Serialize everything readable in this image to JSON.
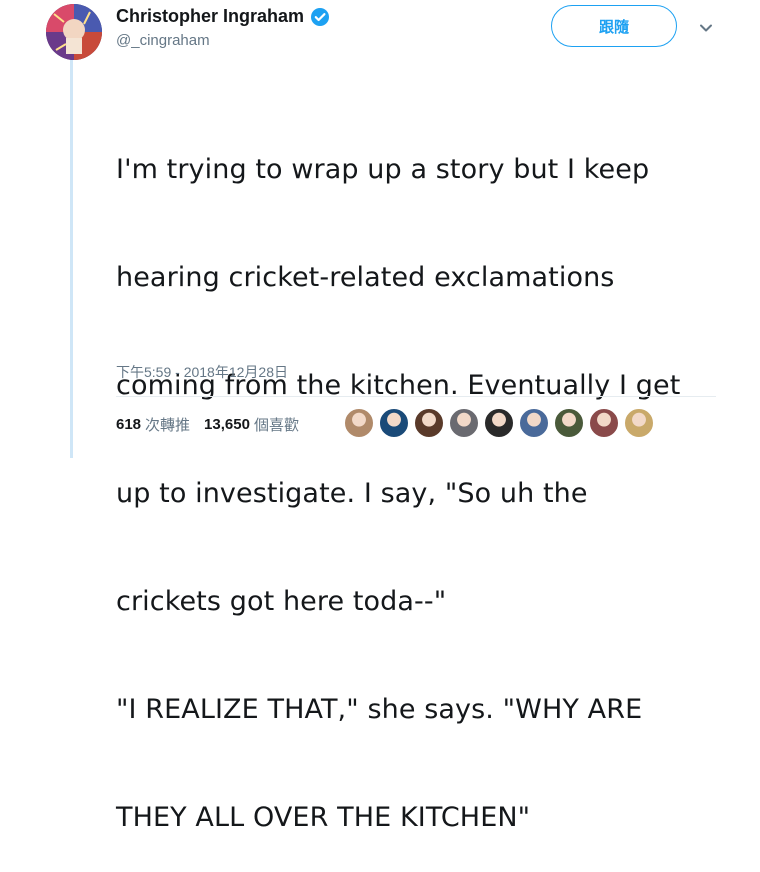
{
  "author": {
    "display_name": "Christopher Ingraham",
    "handle": "@_cingraham",
    "verified": true
  },
  "follow_button": {
    "label": "跟隨"
  },
  "tweet": {
    "lines": [
      "I'm trying to wrap up a story but I keep",
      "hearing cricket-related exclamations",
      "coming from the kitchen. Eventually I get",
      "up to investigate. I say, \"So uh the",
      "crickets got here toda--\"",
      "\"I REALIZE THAT,\" she says. \"WHY ARE",
      "THEY ALL OVER THE KITCHEN\""
    ],
    "timestamp": "下午5:59 - 2018年12月28日"
  },
  "stats": {
    "retweets_count": "618",
    "retweets_label": "次轉推",
    "likes_count": "13,650",
    "likes_label": "個喜歡"
  },
  "likers": [
    {
      "icon": "liker-avatar",
      "color": "#b08a6a"
    },
    {
      "icon": "liker-avatar",
      "color": "#1a4a78"
    },
    {
      "icon": "liker-avatar",
      "color": "#5a3a2a"
    },
    {
      "icon": "liker-avatar",
      "color": "#6a6a70"
    },
    {
      "icon": "liker-avatar",
      "color": "#2a2a2a"
    },
    {
      "icon": "liker-avatar",
      "color": "#4a6a9a"
    },
    {
      "icon": "liker-avatar",
      "color": "#4a5a3a"
    },
    {
      "icon": "liker-avatar",
      "color": "#8a4a4a"
    },
    {
      "icon": "liker-avatar",
      "color": "#c9a96a"
    }
  ],
  "colors": {
    "accent": "#1da1f2",
    "secondary_text": "#657786",
    "thread_line": "#cfe6f7"
  }
}
